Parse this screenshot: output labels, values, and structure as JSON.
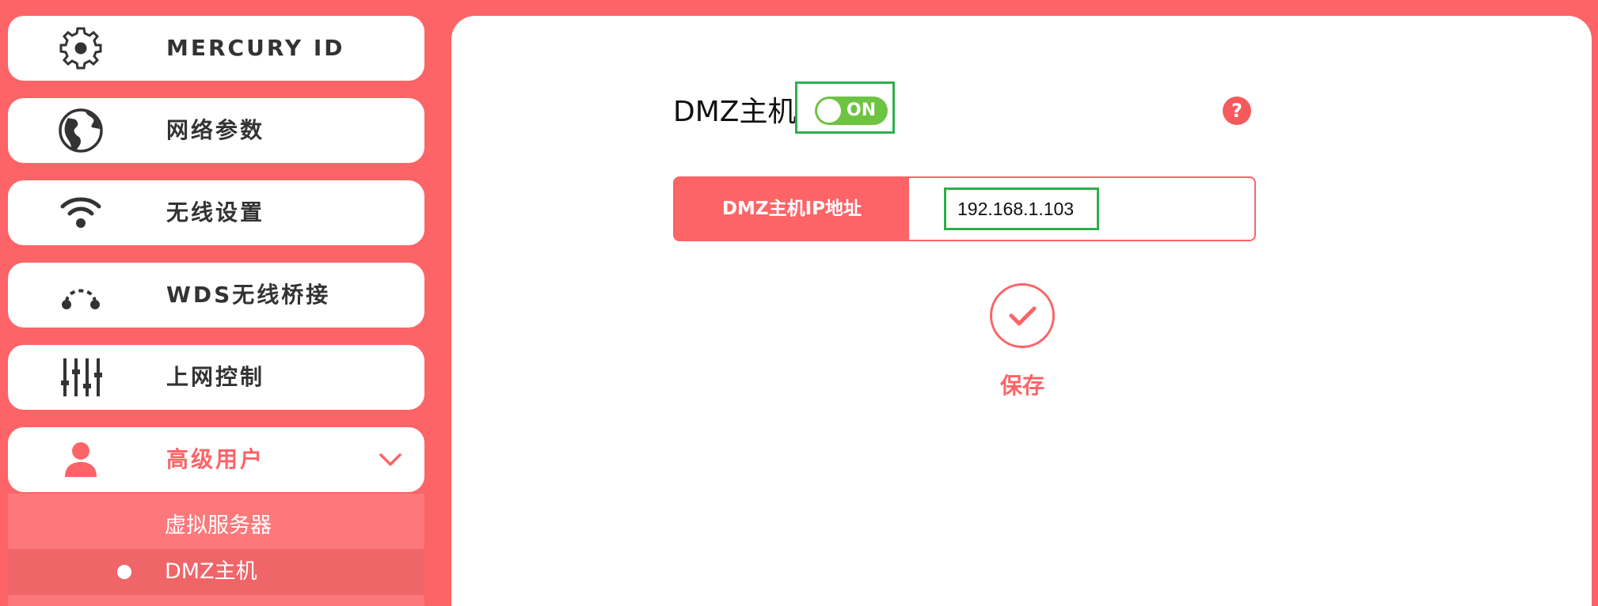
{
  "colors": {
    "accent": "#fc6467",
    "panel": "#ffffff",
    "toggle_on": "#6dc342",
    "highlight_box": "#2fae4c"
  },
  "sidebar": {
    "items": [
      {
        "label": "MERCURY ID",
        "icon": "gear-icon"
      },
      {
        "label": "网络参数",
        "icon": "globe-icon"
      },
      {
        "label": "无线设置",
        "icon": "wifi-icon"
      },
      {
        "label": "WDS无线桥接",
        "icon": "bridge-icon"
      },
      {
        "label": "上网控制",
        "icon": "sliders-icon"
      },
      {
        "label": "高级用户",
        "icon": "user-icon",
        "expanded": true
      }
    ],
    "submenu": [
      {
        "label": "虚拟服务器"
      },
      {
        "label": "DMZ主机",
        "selected": true
      }
    ]
  },
  "main": {
    "dmz_title": "DMZ主机",
    "toggle_text": "ON",
    "toggle_on": true,
    "help_icon_text": "?",
    "ip_label": "DMZ主机IP地址",
    "ip_value": "192.168.1.103",
    "save_label": "保存"
  }
}
